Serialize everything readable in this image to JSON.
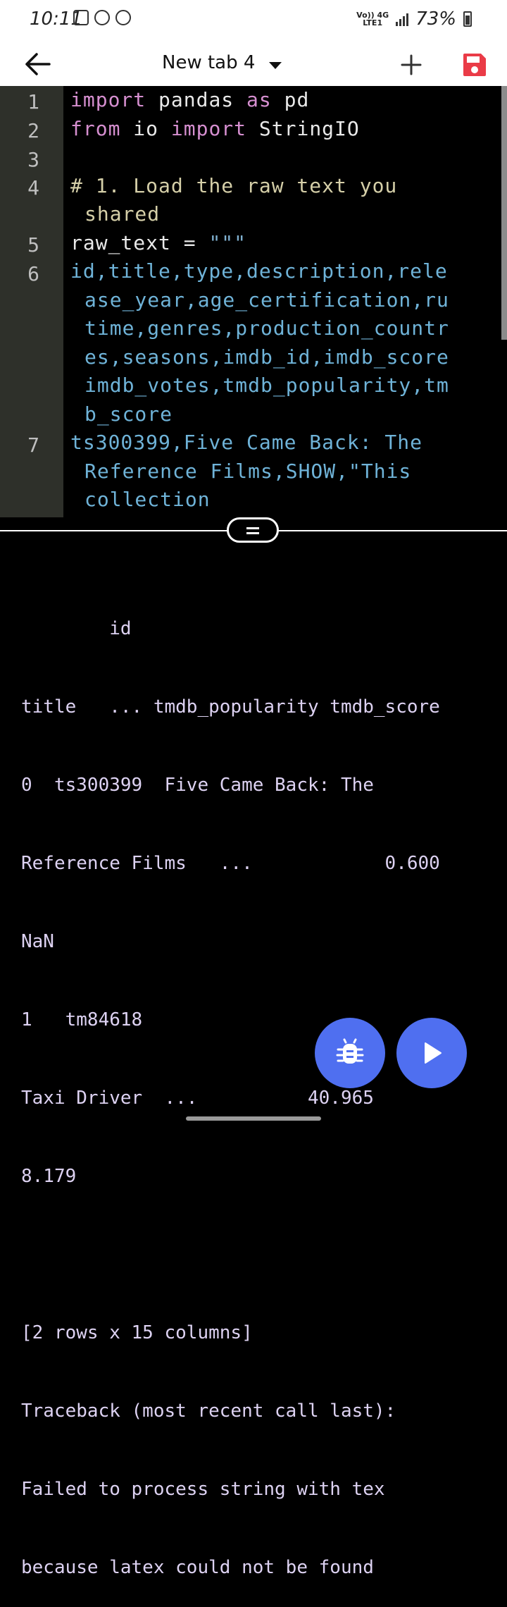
{
  "status_bar": {
    "time": "10:11",
    "network_top": "Vo)) 4G",
    "network_bottom": "LTE1",
    "battery": "73%"
  },
  "app_bar": {
    "tab_title": "New tab 4",
    "icons": [
      "back-arrow-icon",
      "chevron-down-icon",
      "plus-icon",
      "save-icon"
    ],
    "save_color": "#ea3b47"
  },
  "editor": {
    "line_numbers": [
      "1",
      "2",
      "3",
      "4",
      "5",
      "6",
      "7"
    ],
    "lines": {
      "l1_kw": "import",
      "l1_a": " pandas ",
      "l1_kw2": "as",
      "l1_b": " pd",
      "l2_kw": "from",
      "l2_a": " io ",
      "l2_kw2": "import",
      "l2_b": " StringIO",
      "l4_a": "# 1. Load the raw text you",
      "l4_b": "shared",
      "l5_a": "raw_text = ",
      "l5_str": "\"\"\"",
      "l6_a": "id,title,type,description,rele",
      "l6_b": "ase_year,age_certification,ru",
      "l6_c": "time,genres,production_countr",
      "l6_d": "es,seasons,imdb_id,imdb_score",
      "l6_e": "imdb_votes,tmdb_popularity,tm",
      "l6_f": "b_score",
      "l7_a": "ts300399,Five Came Back: The",
      "l7_b": "Reference Films,SHOW,\"This",
      "l7_c": "collection"
    },
    "colors": {
      "keyword": "#d68fd0",
      "comment": "#d5cfa8",
      "string": "#6fb3d8",
      "gutter": "#2e302a"
    }
  },
  "output": {
    "lines": [
      "        id",
      "title   ... tmdb_popularity tmdb_score",
      "0  ts300399  Five Came Back: The",
      "Reference Films   ...            0.600",
      "NaN",
      "1   tm84618",
      "Taxi Driver  ...          40.965",
      "8.179",
      "",
      "[2 rows x 15 columns]",
      "Traceback (most recent call last):",
      "Failed to process string with tex",
      "because latex could not be found"
    ]
  },
  "fabs": {
    "icons": [
      "bug-icon",
      "play-icon"
    ],
    "color": "#4f6ff0"
  }
}
